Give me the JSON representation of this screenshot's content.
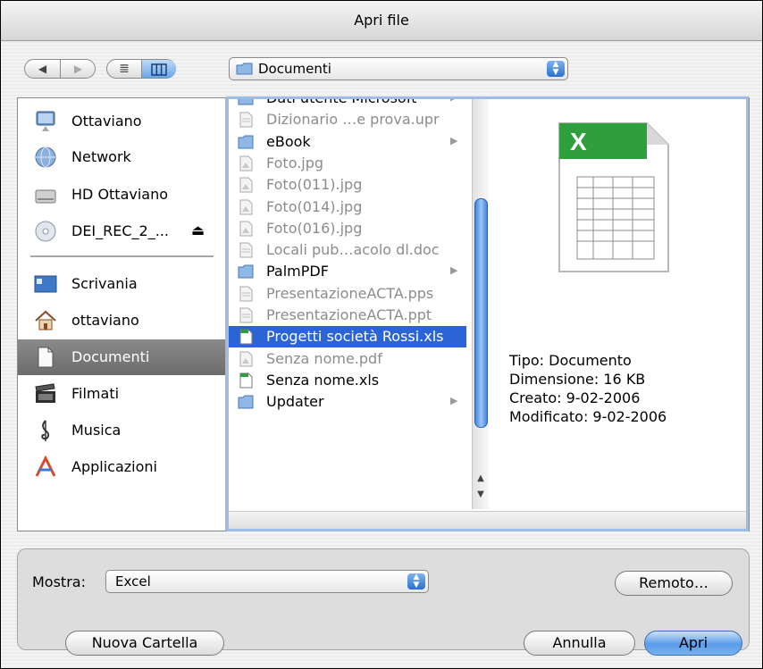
{
  "window": {
    "title": "Apri file"
  },
  "toolbar": {
    "nav": {
      "back_icon": "back-arrow",
      "forward_icon": "forward-arrow"
    },
    "view": {
      "list_icon": "list-view",
      "column_icon": "column-view"
    },
    "location": {
      "value": "Documenti",
      "icon": "folder-icon"
    }
  },
  "sidebar": {
    "devices": [
      {
        "label": "Ottaviano",
        "icon": "computer-icon"
      },
      {
        "label": "Network",
        "icon": "network-globe-icon"
      },
      {
        "label": "HD Ottaviano",
        "icon": "hard-drive-icon"
      },
      {
        "label": "DEI_REC_2_...",
        "icon": "cd-icon",
        "eject": "⏏"
      }
    ],
    "places": [
      {
        "label": "Scrivania",
        "icon": "desktop-icon"
      },
      {
        "label": "ottaviano",
        "icon": "home-icon"
      },
      {
        "label": "Documenti",
        "icon": "documents-icon",
        "selected": true
      },
      {
        "label": "Filmati",
        "icon": "clapperboard-icon"
      },
      {
        "label": "Musica",
        "icon": "music-note-icon"
      },
      {
        "label": "Applicazioni",
        "icon": "applications-icon"
      }
    ]
  },
  "files": [
    {
      "name": "Dati utente Microsoft",
      "kind": "folder",
      "dim": false,
      "arrow": "▶"
    },
    {
      "name": "Dizionario …e prova.upr",
      "kind": "file",
      "dim": true
    },
    {
      "name": "eBook",
      "kind": "folder",
      "dim": false,
      "arrow": "▶"
    },
    {
      "name": "Foto.jpg",
      "kind": "image",
      "dim": true
    },
    {
      "name": "Foto(011).jpg",
      "kind": "image",
      "dim": true
    },
    {
      "name": "Foto(014).jpg",
      "kind": "image",
      "dim": true
    },
    {
      "name": "Foto(016).jpg",
      "kind": "image",
      "dim": true
    },
    {
      "name": "Locali pub…acolo dl.doc",
      "kind": "file",
      "dim": true
    },
    {
      "name": "PalmPDF",
      "kind": "folder",
      "dim": false,
      "arrow": "▶"
    },
    {
      "name": "PresentazioneACTA.pps",
      "kind": "file",
      "dim": true
    },
    {
      "name": "PresentazioneACTA.ppt",
      "kind": "file",
      "dim": true
    },
    {
      "name": "Progetti società Rossi.xls",
      "kind": "excel",
      "dim": false,
      "selected": true
    },
    {
      "name": "Senza nome.pdf",
      "kind": "image",
      "dim": true
    },
    {
      "name": "Senza nome.xls",
      "kind": "excel",
      "dim": false
    },
    {
      "name": "Updater",
      "kind": "folder",
      "dim": false,
      "arrow": "▶"
    }
  ],
  "preview": {
    "icon": "excel-document-icon",
    "tipo": "Tipo: Documento",
    "dimensione": "Dimensione: 16 KB",
    "creato": "Creato: 9-02-2006",
    "modificato": "Modificato: 9-02-2006"
  },
  "filter": {
    "label": "Mostra:",
    "value": "Excel"
  },
  "buttons": {
    "remote": "Remoto…",
    "new_folder": "Nuova Cartella",
    "cancel": "Annulla",
    "open": "Apri"
  },
  "colors": {
    "selection": "#2a64d6",
    "accent": "#5a9be8"
  }
}
